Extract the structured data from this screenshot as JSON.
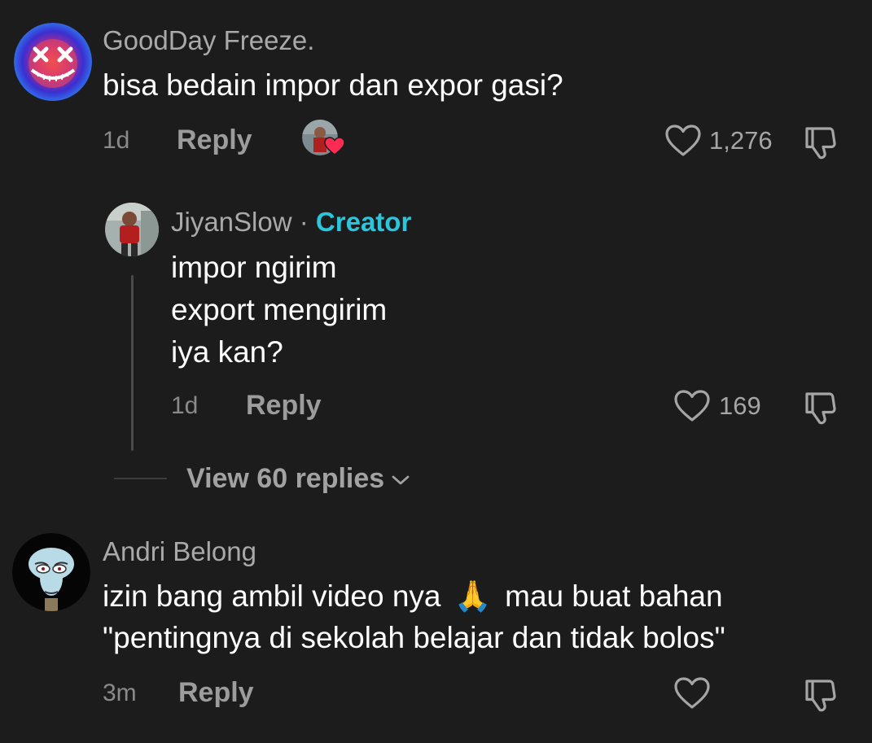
{
  "comments": [
    {
      "username": "GoodDay Freeze.",
      "text": "bisa bedain impor dan expor gasi?",
      "time": "1d",
      "reply_label": "Reply",
      "likes": "1,276",
      "creator_liked": true,
      "replies": [
        {
          "username": "JiyanSlow",
          "separator": "·",
          "badge": "Creator",
          "lines": [
            "impor ngirim",
            "export mengirim",
            "iya kan?"
          ],
          "time": "1d",
          "reply_label": "Reply",
          "likes": "169"
        }
      ],
      "view_replies_label": "View 60 replies"
    },
    {
      "username": "Andri Belong",
      "text_line1_a": "izin bang ambil video nya",
      "emoji": "🙏",
      "text_line1_b": "mau buat bahan",
      "text_line2": "\"pentingnya di sekolah belajar dan tidak bolos\"",
      "time": "3m",
      "reply_label": "Reply",
      "likes": ""
    }
  ],
  "icons": {
    "like": "heart-outline-icon",
    "dislike": "thumbs-down-outline-icon",
    "chevron": "chevron-down-icon",
    "creator_liked": "creator-liked-heart-icon"
  },
  "colors": {
    "background": "#1c1c1c",
    "creator_badge": "#2cc6dc",
    "liked_heart": "#fe2c55"
  }
}
